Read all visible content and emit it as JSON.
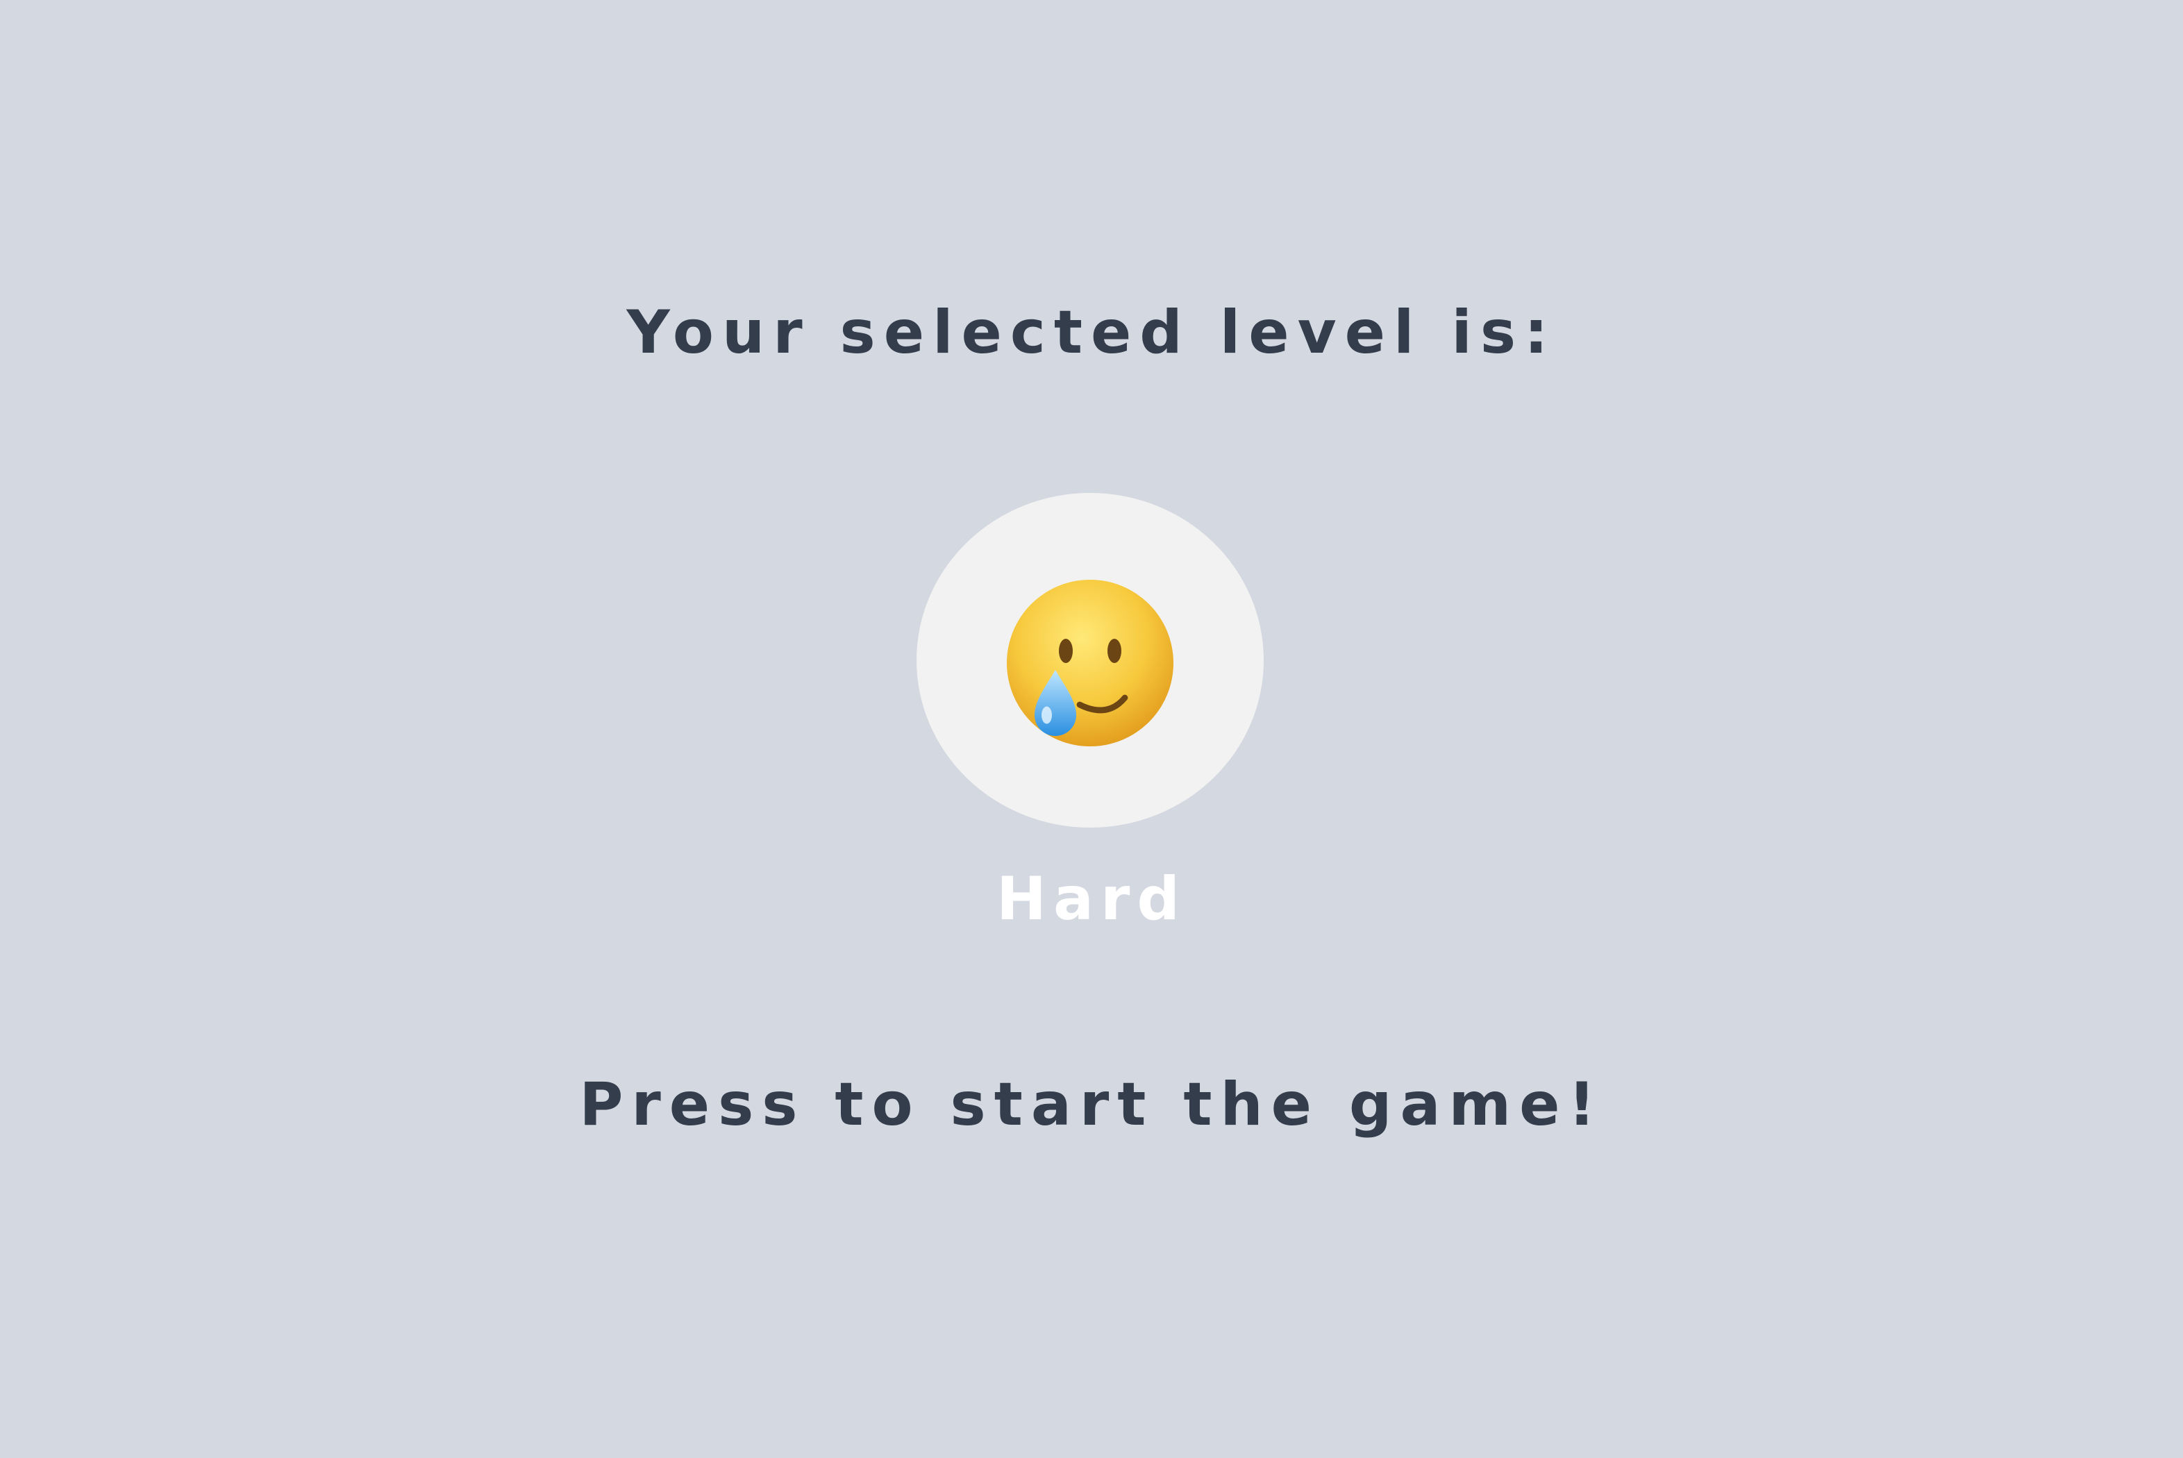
{
  "title": "Your selected level is:",
  "level": {
    "name": "Hard",
    "icon": "smiling-face-with-tear-icon"
  },
  "start_prompt": "Press to start the game!",
  "colors": {
    "background": "#d4d8e0",
    "text": "#333d4c",
    "badge": "#f2f2f2",
    "level_label": "#ffffff"
  }
}
